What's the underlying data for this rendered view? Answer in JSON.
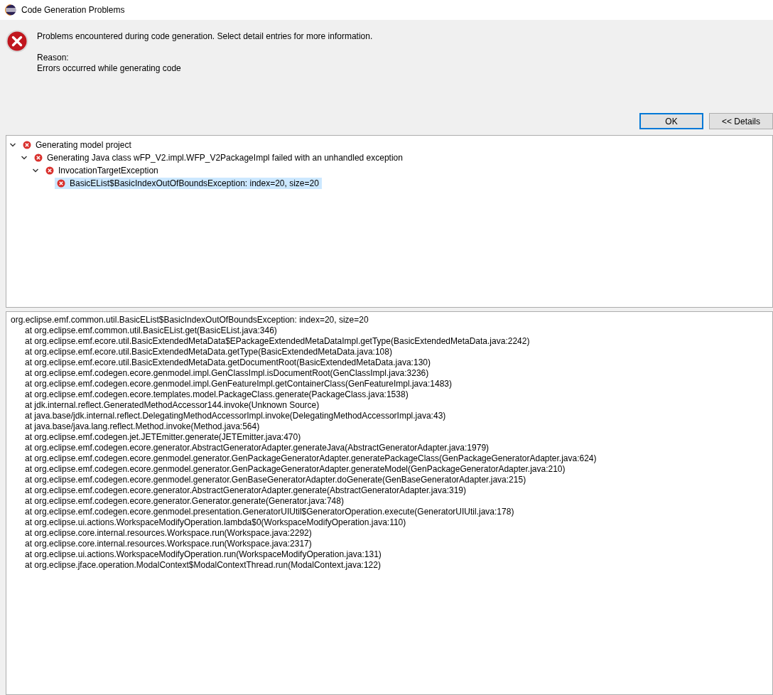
{
  "window": {
    "title": "Code Generation Problems"
  },
  "message": {
    "text": "Problems encountered during code generation. Select detail entries for more information.",
    "reason_label": "Reason:",
    "reason": "Errors occurred while generating code"
  },
  "buttons": [
    {
      "label": "OK",
      "default": true
    },
    {
      "label": "<< Details",
      "default": false
    }
  ],
  "tree": [
    {
      "label": "Generating model project",
      "expanded": true,
      "selected": false,
      "children": [
        {
          "label": "Generating Java class wFP_V2.impl.WFP_V2PackageImpl failed with an unhandled exception",
          "expanded": true,
          "selected": false,
          "children": [
            {
              "label": "InvocationTargetException",
              "expanded": true,
              "selected": false,
              "children": [
                {
                  "label": "BasicEList$BasicIndexOutOfBoundsException: index=20, size=20",
                  "selected": true
                }
              ]
            }
          ]
        }
      ]
    }
  ],
  "details": {
    "exception": "org.eclipse.emf.common.util.BasicEList$BasicIndexOutOfBoundsException: index=20, size=20",
    "frames": [
      "at org.eclipse.emf.common.util.BasicEList.get(BasicEList.java:346)",
      "at org.eclipse.emf.ecore.util.BasicExtendedMetaData$EPackageExtendedMetaDataImpl.getType(BasicExtendedMetaData.java:2242)",
      "at org.eclipse.emf.ecore.util.BasicExtendedMetaData.getType(BasicExtendedMetaData.java:108)",
      "at org.eclipse.emf.ecore.util.BasicExtendedMetaData.getDocumentRoot(BasicExtendedMetaData.java:130)",
      "at org.eclipse.emf.codegen.ecore.genmodel.impl.GenClassImpl.isDocumentRoot(GenClassImpl.java:3236)",
      "at org.eclipse.emf.codegen.ecore.genmodel.impl.GenFeatureImpl.getContainerClass(GenFeatureImpl.java:1483)",
      "at org.eclipse.emf.codegen.ecore.templates.model.PackageClass.generate(PackageClass.java:1538)",
      "at jdk.internal.reflect.GeneratedMethodAccessor144.invoke(Unknown Source)",
      "at java.base/jdk.internal.reflect.DelegatingMethodAccessorImpl.invoke(DelegatingMethodAccessorImpl.java:43)",
      "at java.base/java.lang.reflect.Method.invoke(Method.java:564)",
      "at org.eclipse.emf.codegen.jet.JETEmitter.generate(JETEmitter.java:470)",
      "at org.eclipse.emf.codegen.ecore.generator.AbstractGeneratorAdapter.generateJava(AbstractGeneratorAdapter.java:1979)",
      "at org.eclipse.emf.codegen.ecore.genmodel.generator.GenPackageGeneratorAdapter.generatePackageClass(GenPackageGeneratorAdapter.java:624)",
      "at org.eclipse.emf.codegen.ecore.genmodel.generator.GenPackageGeneratorAdapter.generateModel(GenPackageGeneratorAdapter.java:210)",
      "at org.eclipse.emf.codegen.ecore.genmodel.generator.GenBaseGeneratorAdapter.doGenerate(GenBaseGeneratorAdapter.java:215)",
      "at org.eclipse.emf.codegen.ecore.generator.AbstractGeneratorAdapter.generate(AbstractGeneratorAdapter.java:319)",
      "at org.eclipse.emf.codegen.ecore.generator.Generator.generate(Generator.java:748)",
      "at org.eclipse.emf.codegen.ecore.genmodel.presentation.GeneratorUIUtil$GeneratorOperation.execute(GeneratorUIUtil.java:178)",
      "at org.eclipse.ui.actions.WorkspaceModifyOperation.lambda$0(WorkspaceModifyOperation.java:110)",
      "at org.eclipse.core.internal.resources.Workspace.run(Workspace.java:2292)",
      "at org.eclipse.core.internal.resources.Workspace.run(Workspace.java:2317)",
      "at org.eclipse.ui.actions.WorkspaceModifyOperation.run(WorkspaceModifyOperation.java:131)",
      "at org.eclipse.jface.operation.ModalContext$ModalContextThread.run(ModalContext.java:122)"
    ]
  }
}
